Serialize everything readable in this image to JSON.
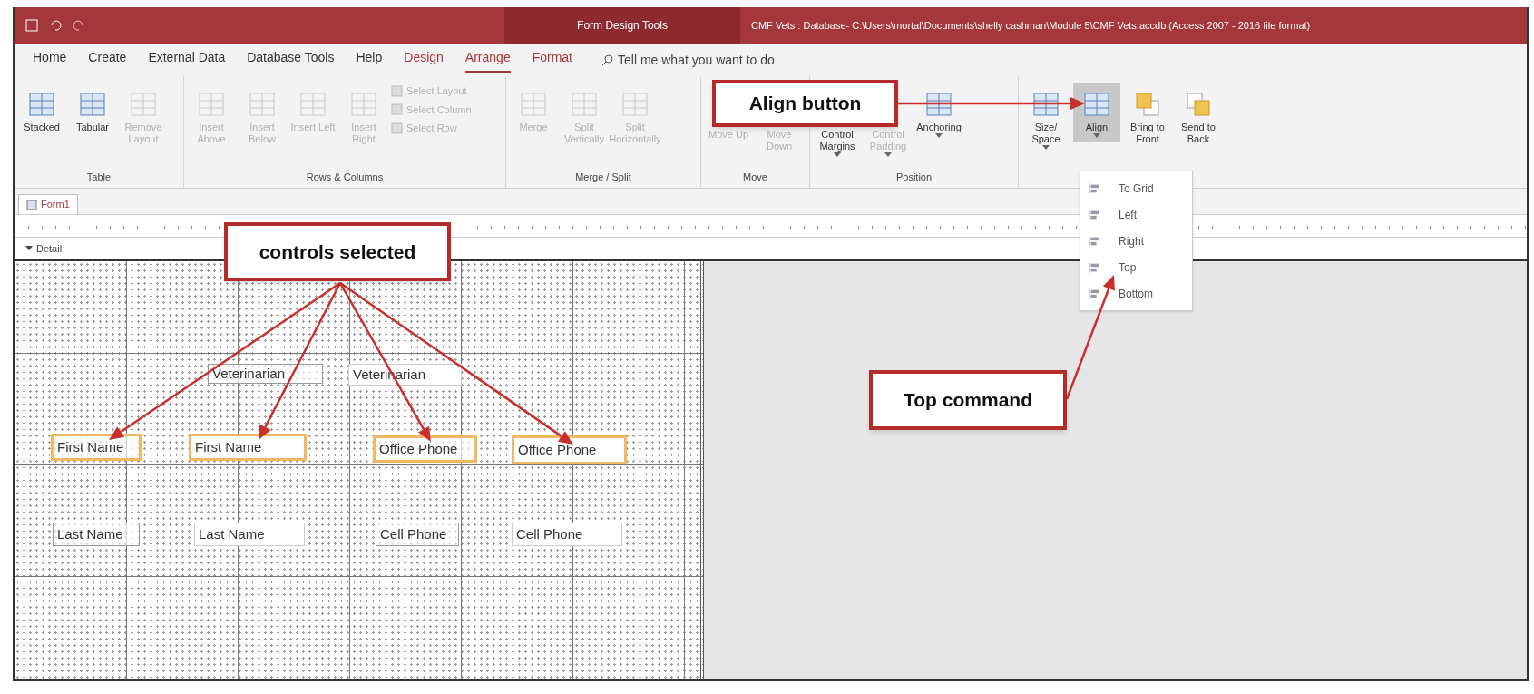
{
  "title_bar": {
    "context_label": "Form Design Tools",
    "title": "CMF Vets : Database- C:\\Users\\mortal\\Documents\\shelly cashman\\Module 5\\CMF Vets.accdb (Access 2007 - 2016 file format)"
  },
  "ribbon_tabs": [
    {
      "label": "Home",
      "selected": false,
      "contextual": false
    },
    {
      "label": "Create",
      "selected": false,
      "contextual": false
    },
    {
      "label": "External Data",
      "selected": false,
      "contextual": false
    },
    {
      "label": "Database Tools",
      "selected": false,
      "contextual": false
    },
    {
      "label": "Help",
      "selected": false,
      "contextual": false
    },
    {
      "label": "Design",
      "selected": false,
      "contextual": true
    },
    {
      "label": "Arrange",
      "selected": true,
      "contextual": true
    },
    {
      "label": "Format",
      "selected": false,
      "contextual": true
    }
  ],
  "tell_me": {
    "placeholder": "Tell me what you want to do"
  },
  "ribbon_groups": [
    {
      "label": "Table",
      "buttons": [
        {
          "kind": "large",
          "label": "Stacked",
          "disabled": false,
          "pressed": false,
          "dropdown": false,
          "covered": false
        },
        {
          "kind": "large",
          "label": "Tabular",
          "disabled": false,
          "pressed": false,
          "dropdown": false,
          "covered": false
        },
        {
          "kind": "large",
          "label": "Remove Layout",
          "disabled": true,
          "pressed": false,
          "dropdown": false,
          "covered": false
        }
      ]
    },
    {
      "label": "Rows & Columns",
      "buttons": [
        {
          "kind": "large",
          "label": "Insert Above",
          "disabled": true,
          "pressed": false,
          "dropdown": false,
          "covered": false
        },
        {
          "kind": "large",
          "label": "Insert Below",
          "disabled": true,
          "pressed": false,
          "dropdown": false,
          "covered": false
        },
        {
          "kind": "large",
          "label": "Insert Left",
          "disabled": true,
          "pressed": false,
          "dropdown": false,
          "covered": false
        },
        {
          "kind": "large",
          "label": "Insert Right",
          "disabled": true,
          "pressed": false,
          "dropdown": false,
          "covered": false
        },
        {
          "kind": "small",
          "label": "Select Layout",
          "disabled": true,
          "pressed": false
        },
        {
          "kind": "small",
          "label": "Select Column",
          "disabled": true,
          "pressed": false
        },
        {
          "kind": "small",
          "label": "Select Row",
          "disabled": true,
          "pressed": false
        }
      ]
    },
    {
      "label": "Merge / Split",
      "buttons": [
        {
          "kind": "large",
          "label": "Merge",
          "disabled": true,
          "pressed": false,
          "dropdown": false,
          "covered": false
        },
        {
          "kind": "large",
          "label": "Split Vertically",
          "disabled": true,
          "pressed": false,
          "dropdown": false,
          "covered": false
        },
        {
          "kind": "large",
          "label": "Split Horizontally",
          "disabled": true,
          "pressed": false,
          "dropdown": false,
          "covered": false
        }
      ]
    },
    {
      "label": "Move",
      "buttons": [
        {
          "kind": "large",
          "label": "Move Up",
          "disabled": true,
          "pressed": false,
          "dropdown": false,
          "covered": true
        },
        {
          "kind": "large",
          "label": "Move Down",
          "disabled": true,
          "pressed": false,
          "dropdown": false,
          "covered": true
        }
      ]
    },
    {
      "label": "Position",
      "buttons": [
        {
          "kind": "large",
          "label": "Control Margins",
          "disabled": false,
          "pressed": false,
          "dropdown": true,
          "covered": true
        },
        {
          "kind": "large",
          "label": "Control Padding",
          "disabled": true,
          "pressed": false,
          "dropdown": true,
          "covered": true
        },
        {
          "kind": "large",
          "label": "Anchoring",
          "disabled": false,
          "pressed": false,
          "dropdown": true,
          "covered": false
        }
      ]
    },
    {
      "buttons": [
        {
          "kind": "large",
          "label": "Size/ Space",
          "disabled": false,
          "pressed": false,
          "dropdown": true,
          "covered": false
        },
        {
          "kind": "large",
          "label": "Align",
          "disabled": false,
          "pressed": true,
          "dropdown": true,
          "covered": false
        },
        {
          "kind": "large",
          "label": "Bring to Front",
          "disabled": false,
          "pressed": false,
          "dropdown": false,
          "covered": false
        },
        {
          "kind": "large",
          "label": "Send to Back",
          "disabled": false,
          "pressed": false,
          "dropdown": false,
          "covered": false
        }
      ]
    }
  ],
  "align_menu": [
    {
      "label": "To Grid"
    },
    {
      "label": "Left"
    },
    {
      "label": "Right"
    },
    {
      "label": "Top"
    },
    {
      "label": "Bottom"
    }
  ],
  "document": {
    "tab": "Form1",
    "section": "Detail",
    "controls": [
      {
        "kind": "label",
        "text": "Veterinarian",
        "selected": false
      },
      {
        "kind": "textbox",
        "text": "Veterinarian",
        "selected": false
      },
      {
        "kind": "label",
        "text": "First Name",
        "selected": true
      },
      {
        "kind": "textbox",
        "text": "First Name",
        "selected": true
      },
      {
        "kind": "label",
        "text": "Office Phone",
        "selected": true
      },
      {
        "kind": "textbox",
        "text": "Office Phone",
        "selected": true
      },
      {
        "kind": "label",
        "text": "Last Name",
        "selected": false
      },
      {
        "kind": "textbox",
        "text": "Last Name",
        "selected": false
      },
      {
        "kind": "label",
        "text": "Cell Phone",
        "selected": false
      },
      {
        "kind": "textbox",
        "text": "Cell Phone",
        "selected": false
      }
    ]
  },
  "callouts": [
    {
      "text": "Align button"
    },
    {
      "text": "controls selected"
    },
    {
      "text": "Top command"
    }
  ]
}
